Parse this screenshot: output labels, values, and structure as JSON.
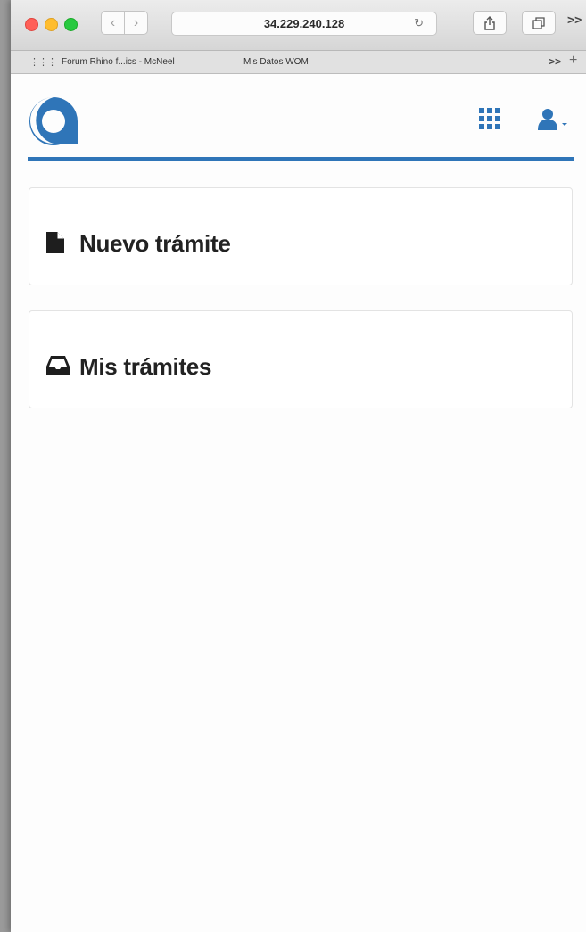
{
  "browser": {
    "url": "34.229.240.128",
    "bookmarks": [
      "Forum Rhino f...ics - McNeel",
      "Mis Datos WOM"
    ],
    "bookmarks_more": ">>",
    "toolbar_more": ">>"
  },
  "header": {
    "logo": "app-logo",
    "apps_icon": "grid-icon",
    "user_icon": "user-icon",
    "accent_color": "#2f75b8"
  },
  "menu": {
    "items": [
      {
        "label": "Nuevo trámite",
        "icon": "file-icon"
      },
      {
        "label": "Mis trámites",
        "icon": "inbox-icon"
      }
    ]
  }
}
